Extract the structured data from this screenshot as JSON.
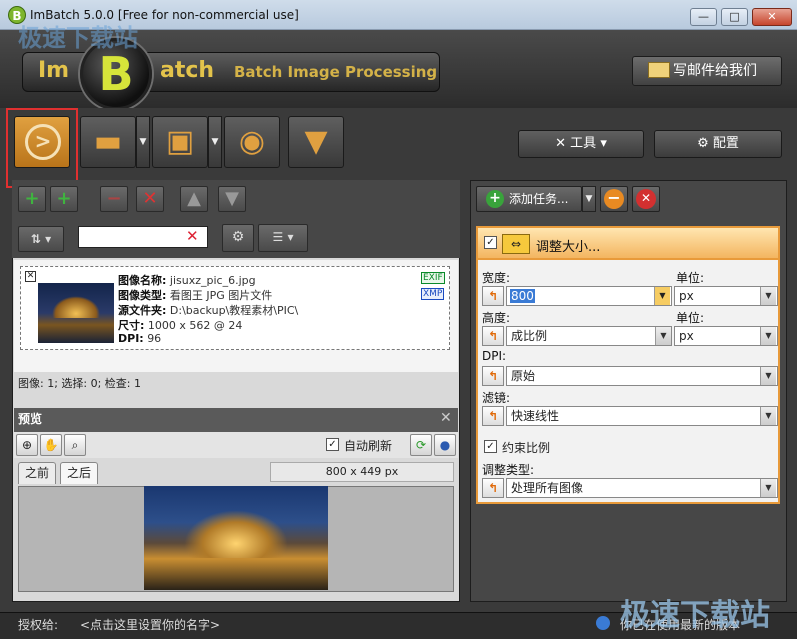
{
  "window": {
    "title": "ImBatch 5.0.0 [Free for non-commercial use]",
    "app_icon": "B",
    "min_label": "—",
    "max_label": "□",
    "close_label": "✕"
  },
  "watermark": {
    "top_left": "极速下载站",
    "bottom_right": "极速下载站"
  },
  "logo": {
    "im": "Im",
    "b": "B",
    "atch": "atch",
    "subtitle": "Batch Image Processing"
  },
  "header": {
    "mail_button": "写邮件给我们"
  },
  "toolbar": {
    "tools_label": "工具",
    "config_label": "配置"
  },
  "file": {
    "name_label": "图像名称:",
    "name_value": "jisuxz_pic_6.jpg",
    "type_label": "图像类型:",
    "type_value": "看图王 JPG 图片文件",
    "source_label": "源文件夹:",
    "source_value": "D:\\backup\\教程素材\\PIC\\",
    "size_label": "尺寸:",
    "size_value": "1000 x 562 @ 24",
    "dpi_label": "DPI:",
    "dpi_value": "96",
    "exif": "EXIF",
    "xmp": "XMP"
  },
  "status": {
    "counts": "图像: 1; 选择: 0; 检查: 1"
  },
  "preview": {
    "title": "预览",
    "auto_refresh": "自动刷新",
    "tab_before": "之前",
    "tab_after": "之后",
    "dimensions": "800 x 449 px"
  },
  "tasks": {
    "add_task": "添加任务...",
    "task_title": "调整大小...",
    "width_label": "宽度:",
    "width_value": "800",
    "width_unit_label": "单位:",
    "width_unit": "px",
    "height_label": "高度:",
    "height_value": "成比例",
    "height_unit_label": "单位:",
    "height_unit": "px",
    "dpi_label": "DPI:",
    "dpi_value": "原始",
    "filter_label": "滤镜:",
    "filter_value": "快速线性",
    "keep_ratio": "约束比例",
    "resize_type_label": "调整类型:",
    "resize_type_value": "处理所有图像"
  },
  "footer": {
    "license_label": "授权给:",
    "license_text": "<点击这里设置你的名字>",
    "latest_text": "你已在使用最新的版本"
  },
  "colors": {
    "accent_orange": "#e0a040",
    "highlight_red": "#e03030",
    "task_border": "#e89a3a"
  }
}
